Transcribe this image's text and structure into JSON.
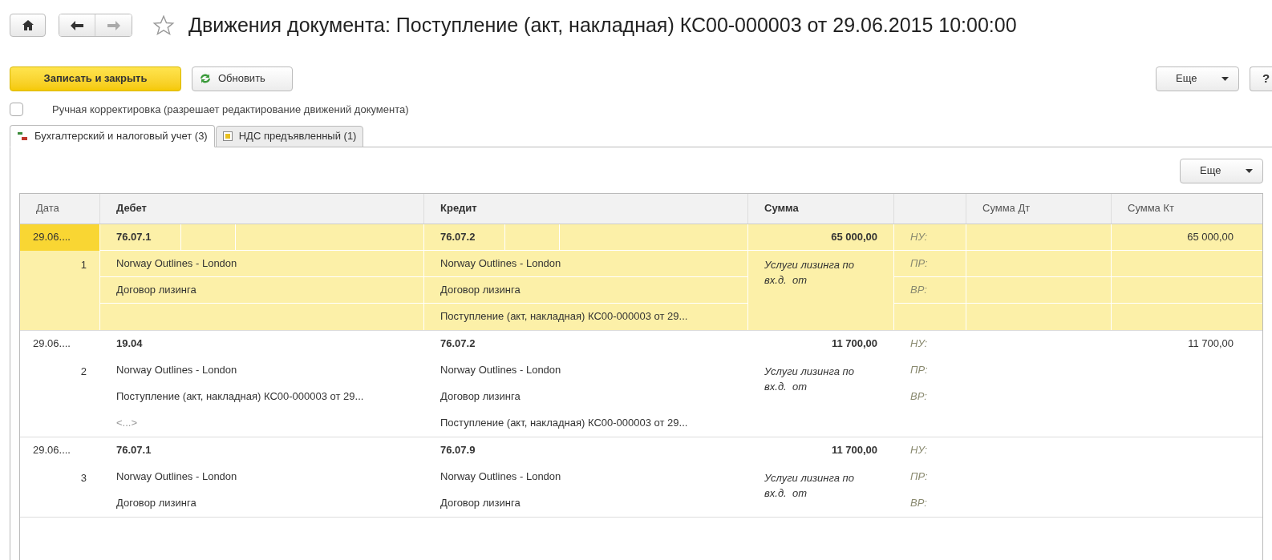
{
  "window": {
    "title": "Движения документа: Поступление (акт, накладная) КС00-000003 от 29.06.2015 10:00:00",
    "favorite": false
  },
  "toolbar": {
    "primary": "Записать и закрыть",
    "refresh": "Обновить",
    "more": "Еще",
    "help": "?"
  },
  "manual_edit": {
    "label": "Ручная корректировка (разрешает редактирование движений документа)",
    "checked": false
  },
  "tabs": [
    {
      "label": "Бухгалтерский и налоговый учет (3)",
      "selected": true,
      "kind": "ledger"
    },
    {
      "label": "НДС предъявленный (1)",
      "selected": false,
      "kind": "vat"
    }
  ],
  "panel_more": "Еще",
  "table": {
    "columns": [
      "Дата",
      "Дебет",
      "Кредит",
      "Сумма",
      "Сумма Дт",
      "Сумма Кт"
    ],
    "rows": [
      {
        "selected": true,
        "date": "29.06....",
        "number": "1",
        "debit": {
          "account": "76.07.1",
          "lines": [
            "Norway Outlines - London",
            "Договор лизинга"
          ]
        },
        "credit": {
          "account": "76.07.2",
          "lines": [
            "Norway Outlines - London",
            "Договор лизинга",
            "Поступление (акт, накладная) КС00-000003 от 29..."
          ]
        },
        "amount": "65 000,00",
        "content": "Услуги лизинга по вх.д.  от",
        "labels": [
          "НУ:",
          "ПР:",
          "ВР:"
        ],
        "sum_kt": "65 000,00"
      },
      {
        "selected": false,
        "date": "29.06....",
        "number": "2",
        "debit": {
          "account": "19.04",
          "lines": [
            "Norway Outlines - London",
            "Поступление (акт, накладная) КС00-000003 от 29...",
            "<...>"
          ]
        },
        "credit": {
          "account": "76.07.2",
          "lines": [
            "Norway Outlines - London",
            "Договор лизинга",
            "Поступление (акт, накладная) КС00-000003 от 29..."
          ]
        },
        "amount": "11 700,00",
        "content": "Услуги лизинга по вх.д.  от",
        "labels": [
          "НУ:",
          "ПР:",
          "ВР:"
        ],
        "sum_kt": "11 700,00"
      },
      {
        "selected": false,
        "date": "29.06....",
        "number": "3",
        "debit": {
          "account": "76.07.1",
          "lines": [
            "Norway Outlines - London",
            "Договор лизинга"
          ]
        },
        "credit": {
          "account": "76.07.9",
          "lines": [
            "Norway Outlines - London",
            "Договор лизинга"
          ]
        },
        "amount": "11 700,00",
        "content": "Услуги лизинга по вх.д.  от",
        "labels": [
          "НУ:",
          "ПР:",
          "ВР:"
        ]
      }
    ]
  }
}
